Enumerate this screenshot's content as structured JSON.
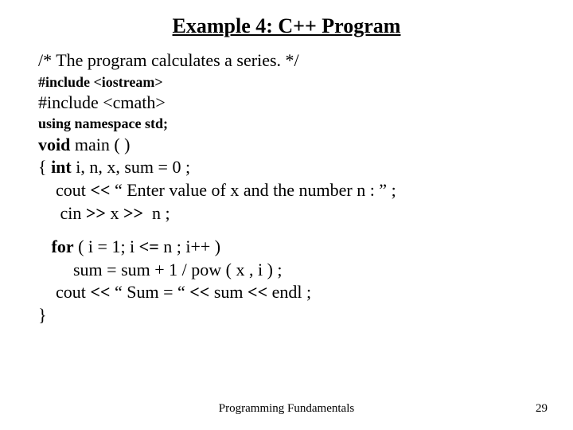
{
  "title": "Example 4: C++ Program",
  "l1": "/* The program calculates a series. */",
  "l2": "#include <iostream>",
  "l3": "#include <cmath>",
  "l4": "using namespace std;",
  "l5a": "void",
  "l5b": " main ( )",
  "l6a": "{ ",
  "l6b": "int",
  "l6c": " i, n, x, sum = 0 ;",
  "l7a": "    cout ",
  "l7b": "<<",
  "l7c": " “ Enter value of x and the number n : ” ;",
  "l8a": "     cin ",
  "l8b": ">>",
  "l8c": " x ",
  "l8d": ">>",
  "l8e": "  n ;",
  "l9a": "   ",
  "l9b": "for",
  "l9c": " ( i = 1; i ",
  "l9d": "<=",
  "l9e": " n ; i++ )",
  "l10": "        sum = sum + 1 / pow ( x , i ) ;",
  "l11a": "    cout ",
  "l11b": "<<",
  "l11c": " “ Sum = “ ",
  "l11d": "<<",
  "l11e": " sum ",
  "l11f": "<<",
  "l11g": " endl ;",
  "l12": "}",
  "footer_center": "Programming Fundamentals",
  "footer_right": "29"
}
